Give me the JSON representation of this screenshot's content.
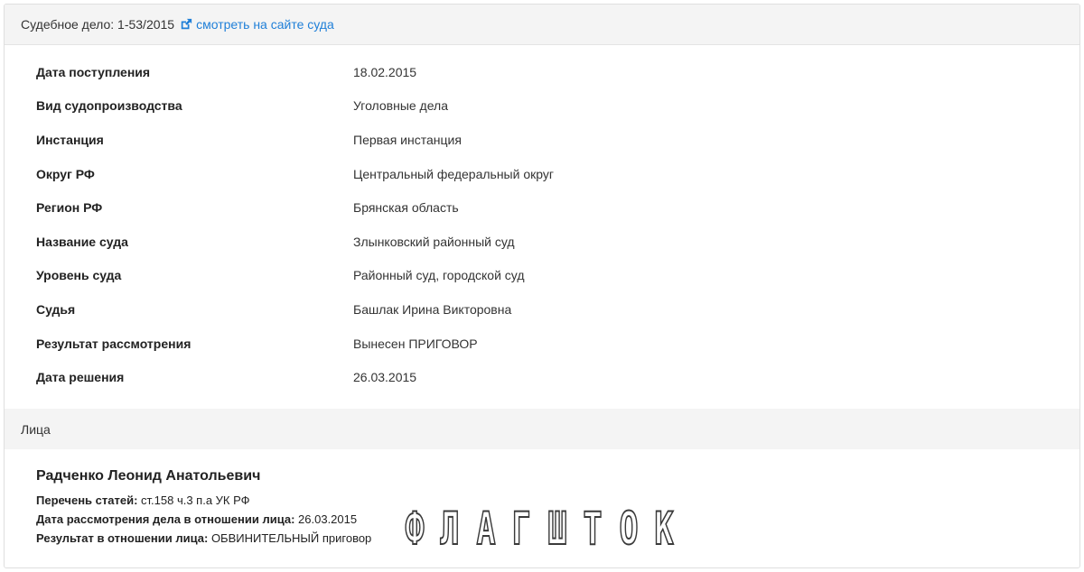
{
  "header": {
    "case_label": "Судебное дело: 1-53/2015",
    "link_text": "смотреть на сайте суда",
    "link_icon": "external-link-icon",
    "link_color": "#1f7fd8"
  },
  "details": [
    {
      "label": "Дата поступления",
      "value": "18.02.2015"
    },
    {
      "label": "Вид судопроизводства",
      "value": "Уголовные дела"
    },
    {
      "label": "Инстанция",
      "value": "Первая инстанция"
    },
    {
      "label": "Округ РФ",
      "value": "Центральный федеральный округ"
    },
    {
      "label": "Регион РФ",
      "value": "Брянская область"
    },
    {
      "label": "Название суда",
      "value": "Злынковский районный суд"
    },
    {
      "label": "Уровень суда",
      "value": "Районный суд, городской суд"
    },
    {
      "label": "Судья",
      "value": "Башлак Ирина Викторовна"
    },
    {
      "label": "Результат рассмотрения",
      "value": "Вынесен ПРИГОВОР"
    },
    {
      "label": "Дата решения",
      "value": "26.03.2015"
    }
  ],
  "persons_section": {
    "title": "Лица"
  },
  "person": {
    "name": "Радченко Леонид Анатольевич",
    "articles_label": "Перечень статей:",
    "articles_value": "ст.158 ч.3 п.а УК РФ",
    "review_date_label": "Дата рассмотрения дела в отношении лица:",
    "review_date_value": "26.03.2015",
    "result_label": "Результат в отношении лица:",
    "result_value": "ОБВИНИТЕЛЬНЫЙ приговор"
  },
  "watermark": {
    "letters": [
      "Ф",
      "Л",
      "А",
      "Г",
      "Ш",
      "Т",
      "О",
      "К"
    ]
  }
}
